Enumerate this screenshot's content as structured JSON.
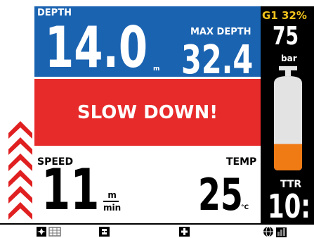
{
  "depth": {
    "label": "DEPTH",
    "value": "14.0",
    "unit": "m"
  },
  "max_depth": {
    "label": "MAX DEPTH",
    "value": "32.4"
  },
  "alert": {
    "text": "SLOW DOWN!"
  },
  "speed": {
    "label": "SPEED",
    "value": "11",
    "unit_top": "m",
    "unit_bottom": "min"
  },
  "temperature": {
    "label": "TEMP",
    "value": "25",
    "unit": "°C"
  },
  "gas": {
    "label": "G1 32%",
    "pressure": "75",
    "pressure_unit": "bar",
    "tank_fill_fraction": 0.28
  },
  "ttr": {
    "label": "TTR",
    "value": "10:"
  },
  "ascent_indicator": {
    "chevrons_lit": 6,
    "color": "#e02020"
  },
  "colors": {
    "depth_panel": "#1a63b1",
    "alert_panel": "#e72a2a",
    "gas_accent": "#f0c21c",
    "tank_fill": "#f07a14",
    "tank_body": "#e3e3e3"
  },
  "softkeys": [
    {
      "name": "compass-logbook-icon"
    },
    {
      "name": "switch-icon"
    },
    {
      "name": "plus-icon"
    },
    {
      "name": "globe-chart-icon"
    }
  ]
}
